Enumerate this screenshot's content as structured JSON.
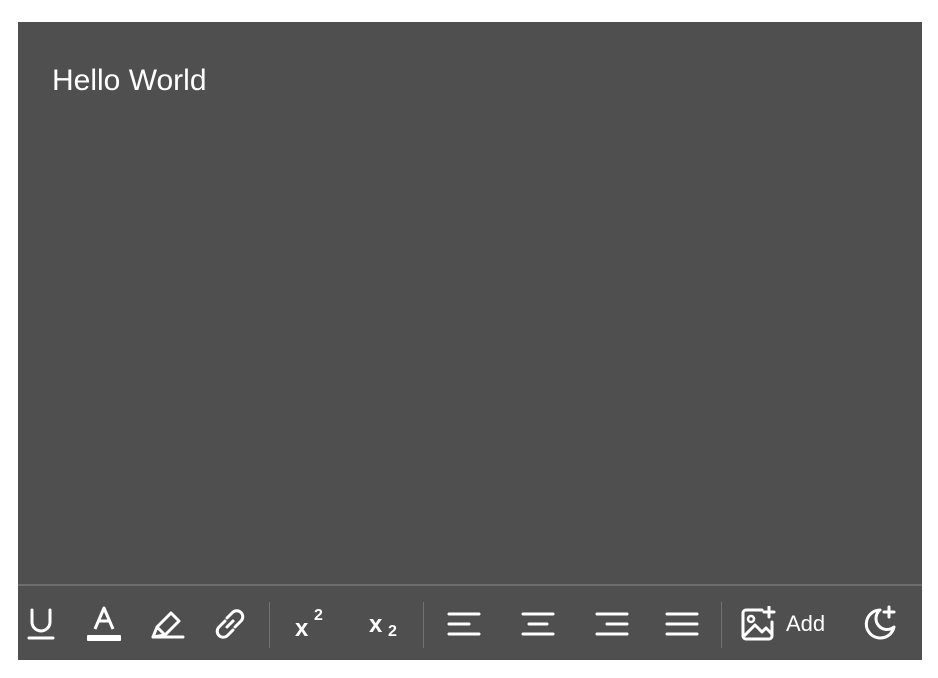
{
  "editor": {
    "content_text": "Hello World"
  },
  "toolbar": {
    "add_image_label": "Add",
    "superscript_glyph": "x",
    "superscript_digit": "2",
    "subscript_glyph": "x",
    "subscript_digit": "2"
  },
  "colors": {
    "editor_background": "#4f4f4f",
    "toolbar_divider": "#6d6d6d",
    "icon_color": "#ffffff"
  }
}
